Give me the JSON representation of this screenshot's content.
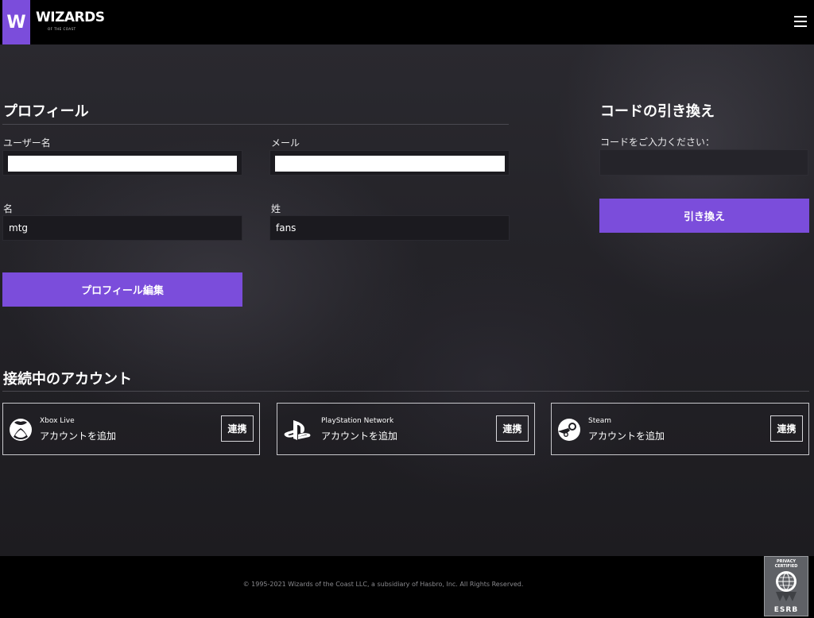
{
  "header": {
    "logo_letter": "W",
    "logo_word": "WIZARDS",
    "logo_sub": "OF THE COAST",
    "menu_icon": "hamburger-menu-icon"
  },
  "profile": {
    "title": "プロフィール",
    "username_label": "ユーザー名",
    "username_value": "",
    "email_label": "メール",
    "email_value": "",
    "first_name_label": "名",
    "first_name_value": "mtg",
    "last_name_label": "姓",
    "last_name_value": "fans",
    "edit_button": "プロフィール編集"
  },
  "redeem": {
    "title": "コードの引き換え",
    "code_label": "コードをご入力ください：",
    "code_value": "",
    "redeem_button": "引き換え"
  },
  "accounts": {
    "title": "接続中のアカウント",
    "items": [
      {
        "name": "Xbox Live",
        "status": "アカウントを追加",
        "link_label": "連携",
        "icon": "xbox-icon"
      },
      {
        "name": "PlayStation Network",
        "status": "アカウントを追加",
        "link_label": "連携",
        "icon": "playstation-icon"
      },
      {
        "name": "Steam",
        "status": "アカウントを追加",
        "link_label": "連携",
        "icon": "steam-icon"
      }
    ]
  },
  "footer": {
    "copyright": "© 1995-2021 Wizards of the Coast LLC, a subsidiary of Hasbro, Inc. All Rights Reserved.",
    "esrb_top": "PRIVACY CERTIFIED",
    "esrb_bottom": "ESRB"
  },
  "colors": {
    "accent": "#7b4ddb",
    "header_bg": "#000000",
    "page_bg": "#1f1e23"
  }
}
